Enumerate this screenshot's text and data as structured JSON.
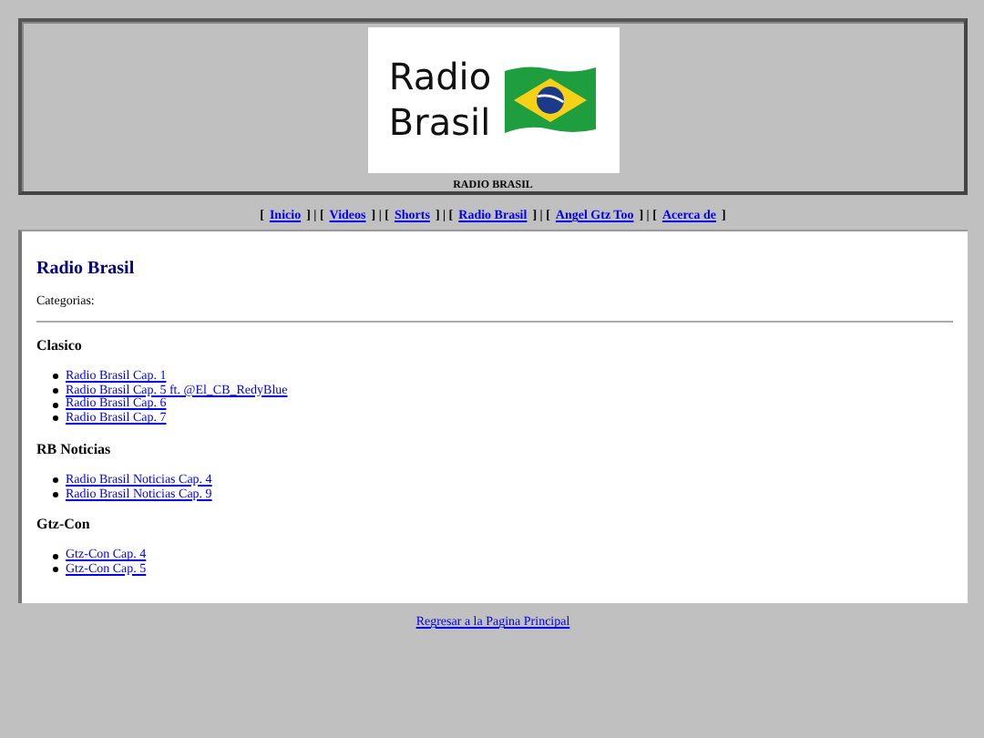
{
  "header": {
    "logo_lines": [
      "Radio",
      "Brasil"
    ],
    "caption": "RADIO BRASIL"
  },
  "nav": {
    "open": "[",
    "separator": "] | [",
    "close": "]",
    "links": [
      "Inicio",
      "Videos",
      "Shorts",
      "Radio Brasil",
      "Angel Gtz Too",
      "Acerca de"
    ]
  },
  "main": {
    "title": "Radio Brasil",
    "subtitle": "Categorias:",
    "categories": [
      {
        "name": "Clasico",
        "links": [
          "Radio Brasil Cap. 1",
          "Radio Brasil Cap. 5 ft. @El_CB_RedyBlue",
          "Radio Brasil Cap. 6",
          "Radio Brasil Cap. 7"
        ]
      },
      {
        "name": "RB Noticias",
        "links": [
          "Radio Brasil Noticias Cap. 4",
          "Radio Brasil Noticias Cap. 9"
        ]
      },
      {
        "name": "Gtz-Con",
        "links": [
          "Gtz-Con Cap. 4",
          "Gtz-Con Cap. 5"
        ]
      }
    ]
  },
  "footer": {
    "link": "Regresar a la Pagina Principal"
  }
}
